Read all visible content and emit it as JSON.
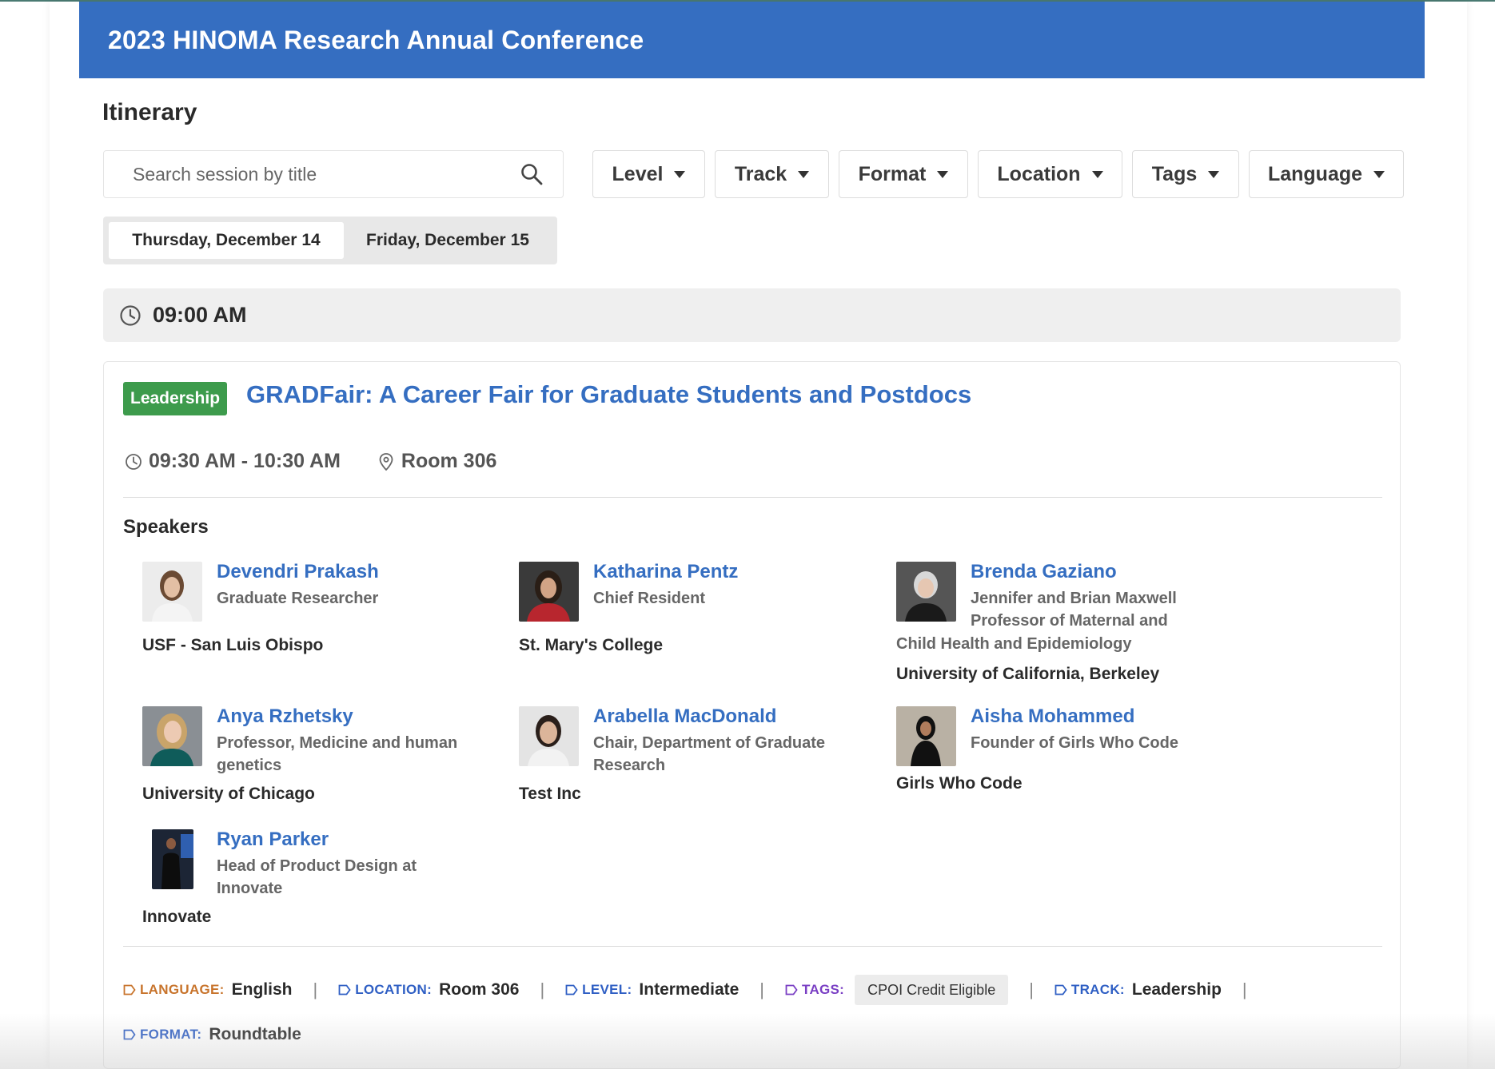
{
  "header": {
    "title": "2023 HINOMA Research Annual Conference"
  },
  "page": {
    "title": "Itinerary"
  },
  "search": {
    "placeholder": "Search session by title"
  },
  "filters": [
    {
      "label": "Level"
    },
    {
      "label": "Track"
    },
    {
      "label": "Format"
    },
    {
      "label": "Location"
    },
    {
      "label": "Tags"
    },
    {
      "label": "Language"
    }
  ],
  "days": [
    {
      "label": "Thursday, December 14",
      "active": true
    },
    {
      "label": "Friday, December 15",
      "active": false
    }
  ],
  "time_block": {
    "time": "09:00 AM"
  },
  "session": {
    "badge": "Leadership",
    "title": "GRADFair: A Career Fair for Graduate Students and Postdocs",
    "time_range": "09:30 AM - 10:30 AM",
    "room": "Room 306",
    "speakers_label": "Speakers",
    "speakers": [
      {
        "name": "Devendri Prakash",
        "role": "Graduate Researcher",
        "org": "USF - San Luis Obispo"
      },
      {
        "name": "Katharina Pentz",
        "role": "Chief Resident",
        "org": "St. Mary's College"
      },
      {
        "name": "Brenda Gaziano",
        "role_line1": "Jennifer and Brian Maxwell",
        "role_line2": "Professor of Maternal and",
        "role_line3": "Child Health and Epidemiology",
        "org": "University of California, Berkeley"
      },
      {
        "name": "Anya Rzhetsky",
        "role_line1": "Professor, Medicine and human",
        "role_line2": "genetics",
        "org": "University of Chicago"
      },
      {
        "name": "Arabella MacDonald",
        "role_line1": "Chair, Department of Graduate",
        "role_line2": "Research",
        "org": "Test Inc"
      },
      {
        "name": "Aisha Mohammed",
        "role": "Founder of Girls Who Code",
        "org": "Girls Who Code"
      },
      {
        "name": "Ryan Parker",
        "role_line1": "Head of Product Design at",
        "role_line2": "Innovate",
        "org": "Innovate"
      }
    ],
    "attributes": {
      "language": {
        "key": "LANGUAGE:",
        "value": "English",
        "color": "#c8742c"
      },
      "location": {
        "key": "LOCATION:",
        "value": "Room 306",
        "color": "#2f5fc4"
      },
      "level": {
        "key": "LEVEL:",
        "value": "Intermediate",
        "color": "#2f5fc4"
      },
      "tags": {
        "key": "TAGS:",
        "value": "CPOI Credit Eligible",
        "color": "#7a3fc4"
      },
      "track": {
        "key": "TRACK:",
        "value": "Leadership",
        "color": "#2f5fc4"
      },
      "format": {
        "key": "FORMAT:",
        "value": "Roundtable",
        "color": "#2f5fc4"
      },
      "separator": "|"
    }
  },
  "colors": {
    "brand_blue": "#356ec1",
    "badge_green": "#3d9b4c"
  }
}
